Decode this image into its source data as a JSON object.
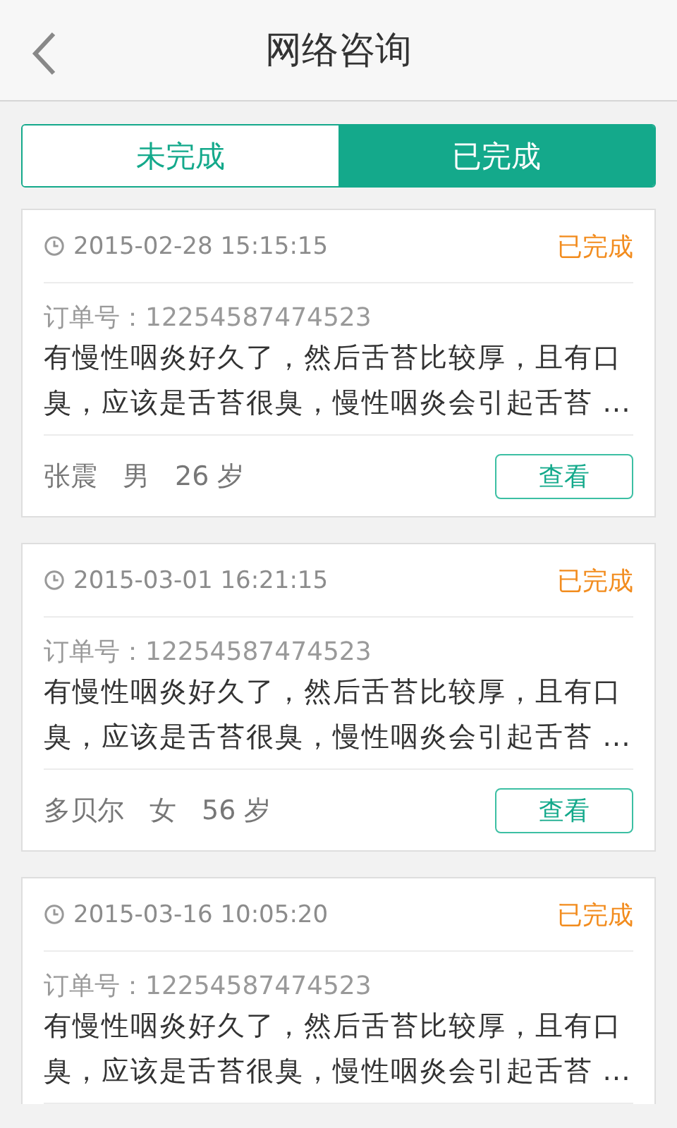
{
  "header": {
    "title": "网络咨询"
  },
  "tabs": [
    {
      "label": "未完成",
      "selected": false
    },
    {
      "label": "已完成",
      "selected": true
    }
  ],
  "orders": [
    {
      "time": "2015-02-28 15:15:15",
      "status": "已完成",
      "order_no": "订单号：12254587474523",
      "description": "有慢性咽炎好久了，然后舌苔比较厚，且有口臭，应该是舌苔很臭，慢性咽炎会引起舌苔 ...",
      "patient": {
        "name": "张震",
        "gender": "男",
        "age": "26 岁"
      },
      "button": "查看"
    },
    {
      "time": "2015-03-01 16:21:15",
      "status": "已完成",
      "order_no": "订单号：12254587474523",
      "description": "有慢性咽炎好久了，然后舌苔比较厚，且有口臭，应该是舌苔很臭，慢性咽炎会引起舌苔 ...",
      "patient": {
        "name": "多贝尔",
        "gender": "女",
        "age": "56 岁"
      },
      "button": "查看"
    },
    {
      "time": "2015-03-16 10:05:20",
      "status": "已完成",
      "order_no": "订单号：12254587474523",
      "description": "有慢性咽炎好久了，然后舌苔比较厚，且有口臭，应该是舌苔很臭，慢性咽炎会引起舌苔 ..."
    }
  ]
}
